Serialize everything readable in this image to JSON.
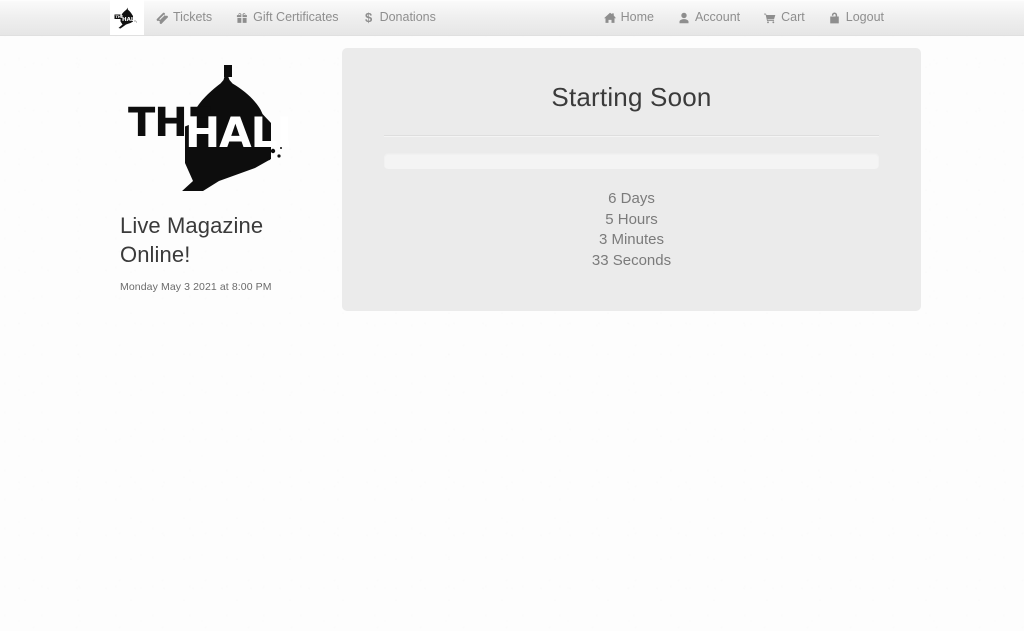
{
  "navbar": {
    "brand": {
      "name": "The Hall",
      "icon": "hall-logo-icon"
    },
    "left_items": [
      {
        "label": "Tickets",
        "icon": "ticket-icon"
      },
      {
        "label": "Gift Certificates",
        "icon": "gift-icon"
      },
      {
        "label": "Donations",
        "icon": "dollar-icon"
      }
    ],
    "right_items": [
      {
        "label": "Home",
        "icon": "home-icon"
      },
      {
        "label": "Account",
        "icon": "user-icon"
      },
      {
        "label": "Cart",
        "icon": "cart-icon"
      },
      {
        "label": "Logout",
        "icon": "lock-icon"
      }
    ]
  },
  "event": {
    "logo_alt": "THE HALL",
    "title": "Live Magazine Online!",
    "date": "Monday May 3 2021 at 8:00 PM"
  },
  "panel": {
    "title": "Starting Soon",
    "progress_percent": 0,
    "countdown": [
      "6 Days",
      "5 Hours",
      "3 Minutes",
      "33 Seconds"
    ]
  },
  "colors": {
    "panel_bg": "#ebebeb",
    "navbar_bg": "#ededed",
    "heading": "#3b3b3b",
    "muted_text": "#7b7b7b",
    "progress_track": "#f4f4f4"
  }
}
